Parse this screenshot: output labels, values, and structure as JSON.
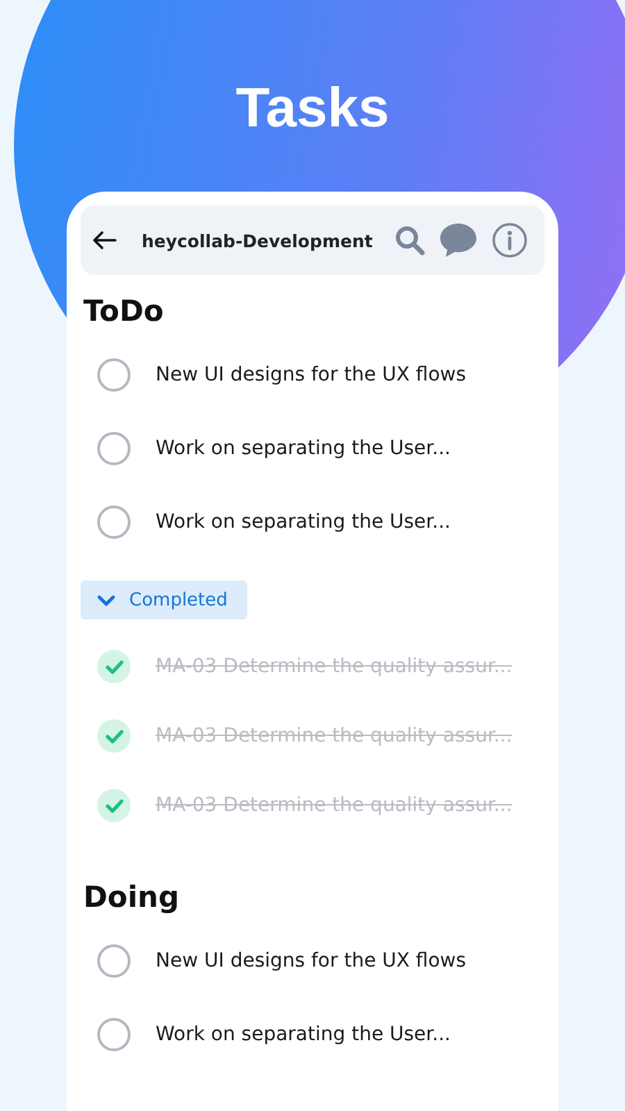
{
  "headline": "Tasks",
  "header": {
    "title": "heycollab-Development"
  },
  "sections": [
    {
      "title": "ToDo",
      "tasks": [
        {
          "text": "New UI designs for the UX flows",
          "checked": false
        },
        {
          "text": "Work on separating the User...",
          "checked": false
        },
        {
          "text": "Work on separating the User...",
          "checked": false
        }
      ],
      "completed": {
        "label": "Completed",
        "expanded": true,
        "tasks": [
          {
            "text": "MA-03 Determine the quality assur...",
            "checked": true
          },
          {
            "text": "MA-03 Determine the quality assur...",
            "checked": true
          },
          {
            "text": "MA-03 Determine the quality assur...",
            "checked": true
          }
        ]
      }
    },
    {
      "title": "Doing",
      "tasks": [
        {
          "text": "New UI designs for the UX flows",
          "checked": false
        },
        {
          "text": "Work on separating the User...",
          "checked": false
        }
      ]
    }
  ]
}
